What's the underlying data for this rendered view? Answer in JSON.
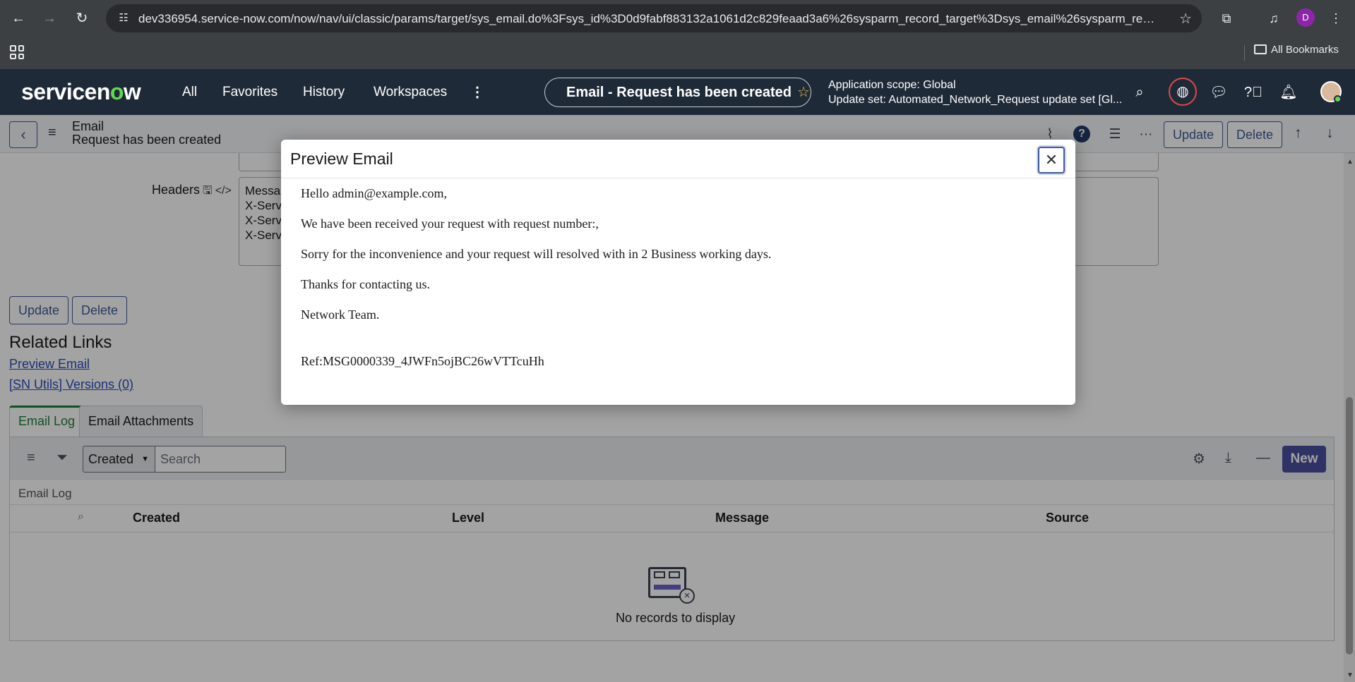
{
  "browser": {
    "url": "dev336954.service-now.com/now/nav/ui/classic/params/target/sys_email.do%3Fsys_id%3D0d9fabf883132a1061d2c829feaad3a6%26sysparm_record_target%3Dsys_email%26sysparm_rec...",
    "profile_initial": "D",
    "all_bookmarks": "All Bookmarks"
  },
  "sn_header": {
    "logo_pre": "servicen",
    "logo_o": "o",
    "logo_post": "w",
    "nav": [
      "All",
      "Favorites",
      "History",
      "Workspaces"
    ],
    "context_pill": "Email - Request has been created",
    "app_scope": "Application scope: Global",
    "update_set": "Update set: Automated_Network_Request update set [Gl..."
  },
  "form_header": {
    "title": "Email",
    "subtitle": "Request has been created",
    "update_label": "Update",
    "delete_label": "Delete"
  },
  "form": {
    "headers_label": "Headers",
    "headers_lines": [
      "Messa",
      "X-Serv",
      "X-Serv",
      "X-Serv"
    ],
    "update_label": "Update",
    "delete_label": "Delete",
    "related_links_title": "Related Links",
    "links": [
      "Preview Email",
      "[SN Utils] Versions (0)"
    ]
  },
  "related_list": {
    "tabs": [
      "Email Log",
      "Email Attachments"
    ],
    "filter_field": "Created",
    "search_placeholder": "Search",
    "new_label": "New",
    "caption": "Email Log",
    "columns": [
      "Created",
      "Level",
      "Message",
      "Source"
    ],
    "empty_text": "No records to display"
  },
  "modal": {
    "title": "Preview Email",
    "lines": [
      "Hello admin@example.com,",
      "We have been received your request with request number:,",
      "Sorry for the inconvenience and your request will resolved with in 2 Business working days.",
      "Thanks for contacting us.",
      "Network Team.",
      "Ref:MSG0000339_4JWFn5ojBC26wVTTcuHh"
    ]
  },
  "colors": {
    "sn_header_bg": "#1f2a38",
    "sn_accent_green": "#62d84e",
    "primary_button": "#4a4f9e",
    "active_tab": "#1b7f3b",
    "link": "#2a4dba"
  }
}
